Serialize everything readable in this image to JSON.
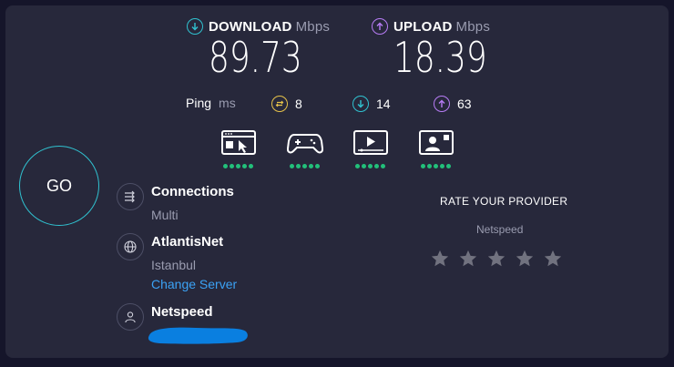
{
  "download": {
    "label": "DOWNLOAD",
    "unit": "Mbps",
    "value": "89.73"
  },
  "upload": {
    "label": "UPLOAD",
    "unit": "Mbps",
    "value": "18.39"
  },
  "ping": {
    "label": "Ping",
    "unit": "ms",
    "idle": "8",
    "down": "14",
    "up": "63"
  },
  "ratings": {
    "browsing": 5,
    "gaming": 5,
    "streaming": 5,
    "video_calls": 5
  },
  "go_label": "GO",
  "connections": {
    "title": "Connections",
    "value": "Multi"
  },
  "server": {
    "name": "AtlantisNet",
    "city": "Istanbul",
    "change_label": "Change Server"
  },
  "provider": {
    "name": "Netspeed"
  },
  "rate": {
    "title": "RATE YOUR PROVIDER",
    "provider": "Netspeed",
    "stars": 5
  },
  "colors": {
    "accent_cyan": "#30c2d0",
    "upload_purple": "#b77cf5",
    "idle_yellow": "#e6c24a",
    "quality_green": "#22c07a",
    "link_blue": "#3ba2f5",
    "redaction_blue": "#0a7fe0"
  }
}
